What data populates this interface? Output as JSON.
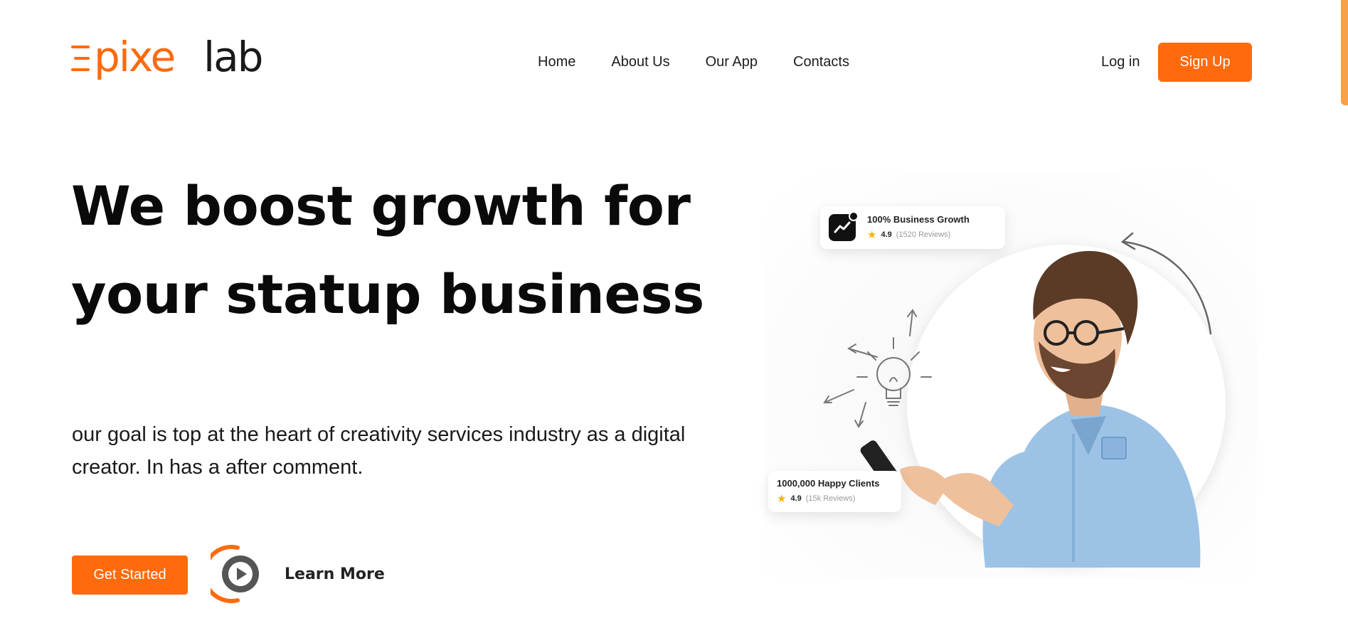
{
  "logo": {
    "left": "Ξ",
    "mid": "pixe",
    "right": "lab",
    "accent": "#ff6a0d",
    "dark": "#1a1a1a"
  },
  "nav": {
    "items": [
      "Home",
      "About Us",
      "Our App",
      "Contacts"
    ]
  },
  "auth": {
    "login": "Log in",
    "signup": "Sign Up"
  },
  "hero": {
    "title_line1": "We boost growth for",
    "title_line2": "your statup business",
    "description": "our goal is top at the heart of creativity services industry as a digital creator. In has a after comment.",
    "cta": "Get Started",
    "learn_more": "Learn More"
  },
  "cards": {
    "growth": {
      "title": "100% Business Growth",
      "rating": "4.9",
      "reviews": "(1520 Reviews)"
    },
    "clients": {
      "title": "1000,000 Happy Clients",
      "rating": "4.9",
      "reviews": "(15k Reviews)"
    }
  },
  "colors": {
    "accent": "#ff6a0d",
    "scrollbar": "#f7a24a",
    "shirt": "#9cc3e6"
  }
}
